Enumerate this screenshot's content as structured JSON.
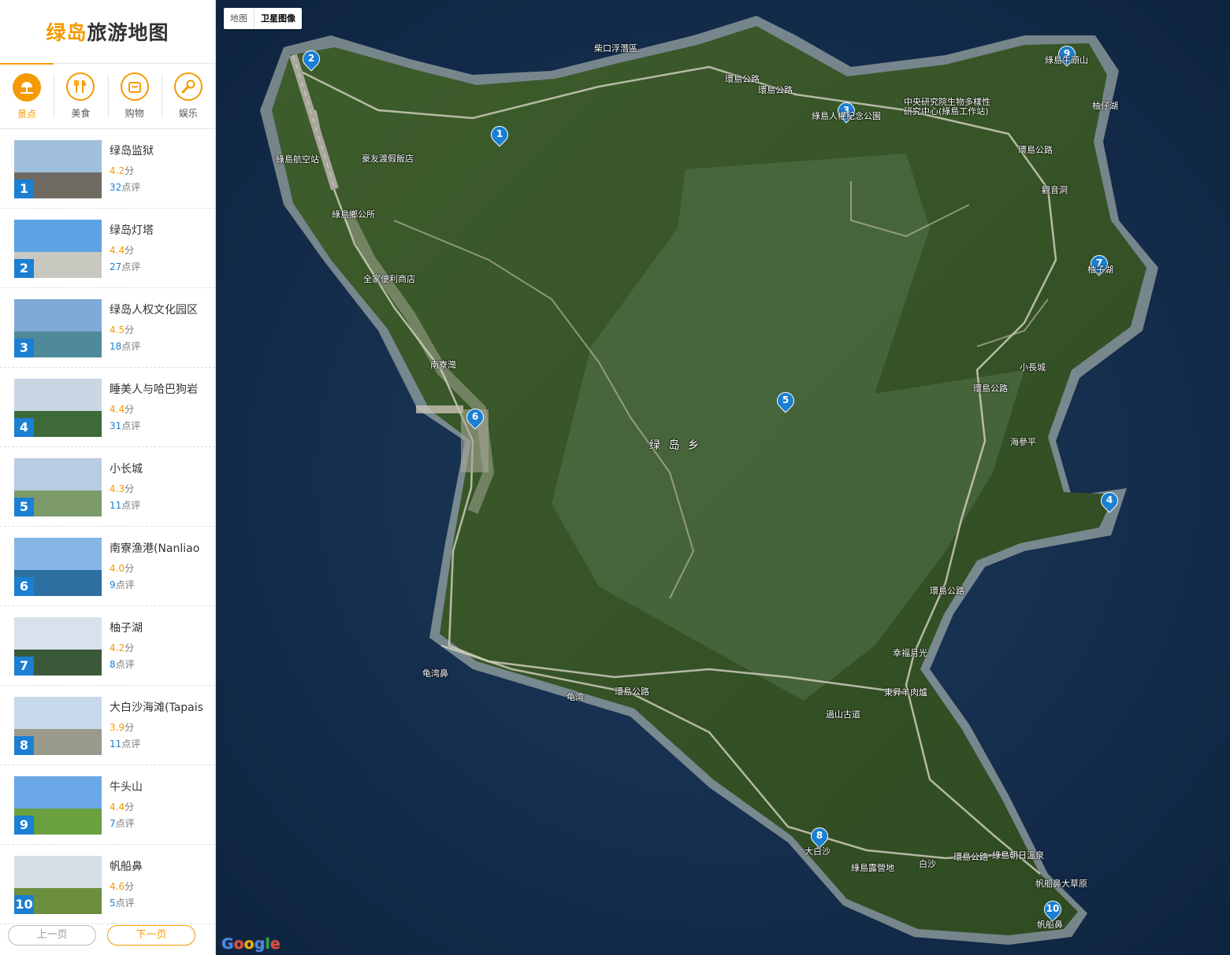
{
  "sidebar": {
    "title_highlight": "绿岛",
    "title_rest": "旅游地图",
    "tabs": [
      {
        "label": "景点",
        "icon": "attraction-icon",
        "active": true
      },
      {
        "label": "美食",
        "icon": "fork-knife-icon",
        "active": false
      },
      {
        "label": "购物",
        "icon": "shopping-bag-icon",
        "active": false
      },
      {
        "label": "娱乐",
        "icon": "microphone-icon",
        "active": false
      }
    ],
    "items": [
      {
        "num": "1",
        "name": "绿岛监狱",
        "score": "4.2",
        "score_unit": "分",
        "reviews": "32",
        "reviews_unit": "点评"
      },
      {
        "num": "2",
        "name": "绿岛灯塔",
        "score": "4.4",
        "score_unit": "分",
        "reviews": "27",
        "reviews_unit": "点评"
      },
      {
        "num": "3",
        "name": "绿岛人权文化园区",
        "score": "4.5",
        "score_unit": "分",
        "reviews": "18",
        "reviews_unit": "点评"
      },
      {
        "num": "4",
        "name": "睡美人与哈巴狗岩",
        "score": "4.4",
        "score_unit": "分",
        "reviews": "31",
        "reviews_unit": "点评"
      },
      {
        "num": "5",
        "name": "小长城",
        "score": "4.3",
        "score_unit": "分",
        "reviews": "11",
        "reviews_unit": "点评"
      },
      {
        "num": "6",
        "name": "南寮渔港(Nanliao",
        "score": "4.0",
        "score_unit": "分",
        "reviews": "9",
        "reviews_unit": "点评"
      },
      {
        "num": "7",
        "name": "柚子湖",
        "score": "4.2",
        "score_unit": "分",
        "reviews": "8",
        "reviews_unit": "点评"
      },
      {
        "num": "8",
        "name": "大白沙海滩(Tapais",
        "score": "3.9",
        "score_unit": "分",
        "reviews": "11",
        "reviews_unit": "点评"
      },
      {
        "num": "9",
        "name": "牛头山",
        "score": "4.4",
        "score_unit": "分",
        "reviews": "7",
        "reviews_unit": "点评"
      },
      {
        "num": "10",
        "name": "帆船鼻",
        "score": "4.6",
        "score_unit": "分",
        "reviews": "5",
        "reviews_unit": "点评"
      }
    ],
    "prev_label": "上一页",
    "next_label": "下一页"
  },
  "map": {
    "type_options": [
      "地图",
      "卫星图像"
    ],
    "selected_type": "卫星图像",
    "pins": [
      "1",
      "2",
      "3",
      "4",
      "5",
      "6",
      "7",
      "8",
      "9",
      "10"
    ],
    "labels": [
      "柴口浮潛區",
      "環島公路",
      "環島公路",
      "綠島人權紀念公園",
      "中央研究院生物多樣性",
      "研究中心(綠島工作站)",
      "綠島牛頭山",
      "柚仔湖",
      "環島公路",
      "觀音洞",
      "綠島航空站",
      "豪友渡假飯店",
      "綠島鄉公所",
      "全家便利商店",
      "南寮灣",
      "柚子湖",
      "小長城",
      "環島公路",
      "海參平",
      "绿 岛 乡",
      "環島公路",
      "幸福月光",
      "東昇羊肉爐",
      "龟湾鼻",
      "龟湾",
      "環島公路",
      "過山古道",
      "大白沙",
      "綠島露營地",
      "白沙",
      "環島公路",
      "綠島朝日溫泉",
      "帆船鼻大草原",
      "帆船鼻"
    ],
    "logo": "Google"
  },
  "colors": {
    "accent": "#f59a00",
    "badge": "#1b7fd3",
    "ocean": "#132d4a",
    "land": "#3b5a2a"
  }
}
